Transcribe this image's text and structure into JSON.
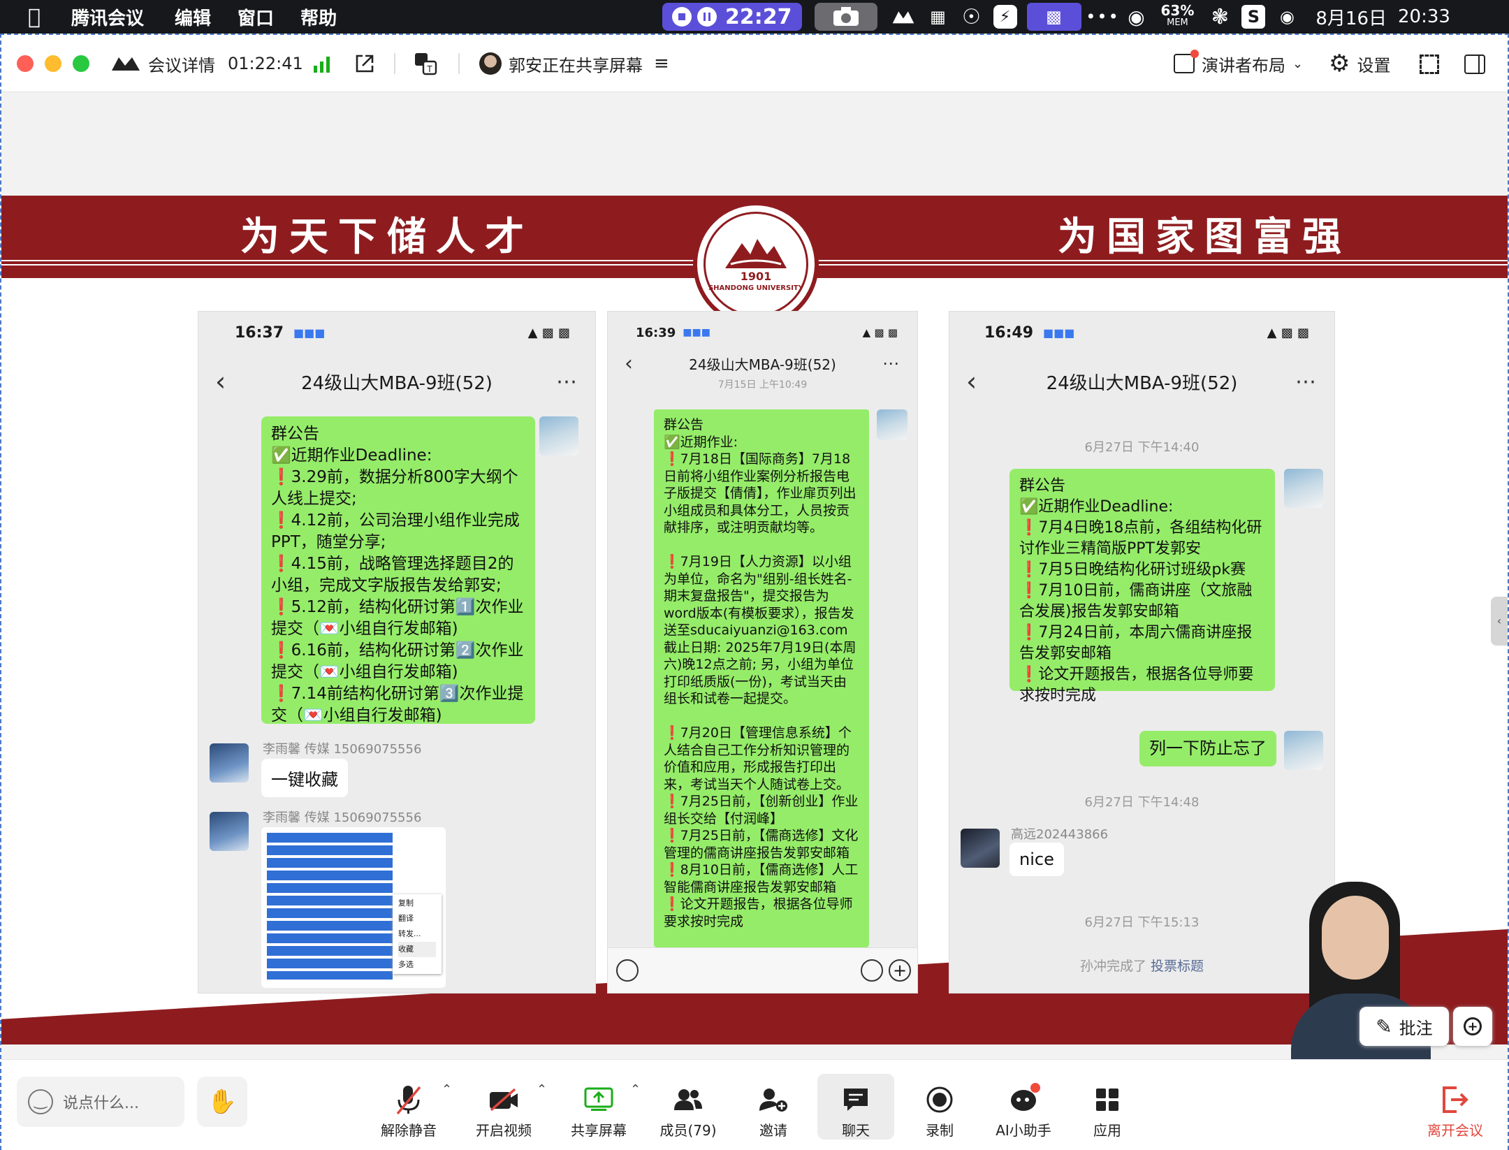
{
  "menubar": {
    "app": "腾讯会议",
    "items": [
      "编辑",
      "窗口",
      "帮助"
    ],
    "rec_time": "22:27",
    "mem_percent": "63%",
    "mem_label": "MEM",
    "date": "8月16日",
    "clock": "20:33"
  },
  "titlebar": {
    "details": "会议详情",
    "duration": "01:22:41",
    "sharing": "郭安正在共享屏幕",
    "layout": "演讲者布局",
    "settings": "设置"
  },
  "slide": {
    "motto_left": "为天下储人才",
    "motto_right": "为国家图富强",
    "seal_year": "1901",
    "seal_text": "SHANDONG UNIVERSITY"
  },
  "phone1": {
    "time": "16:37",
    "title": "24级山大MBA-9班(52)",
    "notice": "群公告\n✅近期作业Deadline:\n❗3.29前，数据分析800字大纲个人线上提交;\n❗4.12前，公司治理小组作业完成PPT，随堂分享;\n❗4.15前，战略管理选择题目2的小组，完成文字版报告发给郭安;\n❗5.12前，结构化研讨第1️⃣次作业提交（💌小组自行发邮箱)\n❗6.16前，结构化研讨第2️⃣次作业提交（💌小组自行发邮箱)\n❗7.14前结构化研讨第3️⃣次作业提交（💌小组自行发邮箱)",
    "sender1": "李雨馨 传媒 15069075556",
    "msg1": "一键收藏",
    "sender2": "李雨馨 传媒 15069075556",
    "menu": [
      "复制",
      "翻译",
      "转发...",
      "收藏",
      "多选"
    ]
  },
  "phone2": {
    "time": "16:39",
    "title": "24级山大MBA-9班(52)",
    "date": "7月15日 上午10:49",
    "notice": "群公告\n✅近期作业:\n❗7月18日【国际商务】7月18日前将小组作业案例分析报告电子版提交【倩倩】，作业扉页列出小组成员和具体分工，人员按贡献排序，或注明贡献均等。\n\n❗7月19日【人力资源】以小组为单位，命名为\"组别-组长姓名-期末复盘报告\"，提交报告为word版本(有模板要求），报告发送至sducaiyuanzi@163.com 截止日期: 2025年7月19日(本周六)晚12点之前; 另，小组为单位打印纸质版(一份)，考试当天由组长和试卷一起提交。\n\n❗7月20日【管理信息系统】个人结合自己工作分析知识管理的价值和应用，形成报告打印出来，考试当天个人随试卷上交。\n❗7月25日前，【创新创业】作业组长交给【付润峰】\n❗7月25日前，【儒商选修】文化管理的儒商讲座报告发郭安邮箱\n❗8月10日前，【儒商选修】人工智能儒商讲座报告发郭安邮箱\n❗论文开题报告，根据各位导师要求按时完成"
  },
  "phone3": {
    "time": "16:49",
    "title": "24级山大MBA-9班(52)",
    "t1": "6月27日 下午14:40",
    "notice": "群公告\n✅近期作业Deadline:\n❗7月4日晚18点前，各组结构化研讨作业三精简版PPT发郭安\n❗7月5日晚结构化研讨班级pk赛\n❗7月10日前，儒商讲座（文旅融合发展)报告发郭安邮箱\n❗7月24日前，本周六儒商讲座报告发郭安邮箱\n❗论文开题报告，根据各位导师要求按时完成",
    "reply": "列一下防止忘了",
    "t2": "6月27日 下午14:48",
    "sender": "高远202443866",
    "msg": "nice",
    "t3": "6月27日 下午15:13",
    "sys_a": "孙冲完成了",
    "sys_b": "投票标题"
  },
  "annot": "批注",
  "toolbar": {
    "chat_placeholder": "说点什么...",
    "unmute": "解除静音",
    "video": "开启视频",
    "share": "共享屏幕",
    "members": "成员(79)",
    "invite": "邀请",
    "chat": "聊天",
    "record": "录制",
    "ai": "AI小助手",
    "apps": "应用",
    "leave": "离开会议"
  },
  "colors": {
    "accent_red": "#8e1c1f",
    "wechat_green": "#95ec69",
    "leave_red": "#e0473d",
    "share_green": "#1aad19"
  }
}
